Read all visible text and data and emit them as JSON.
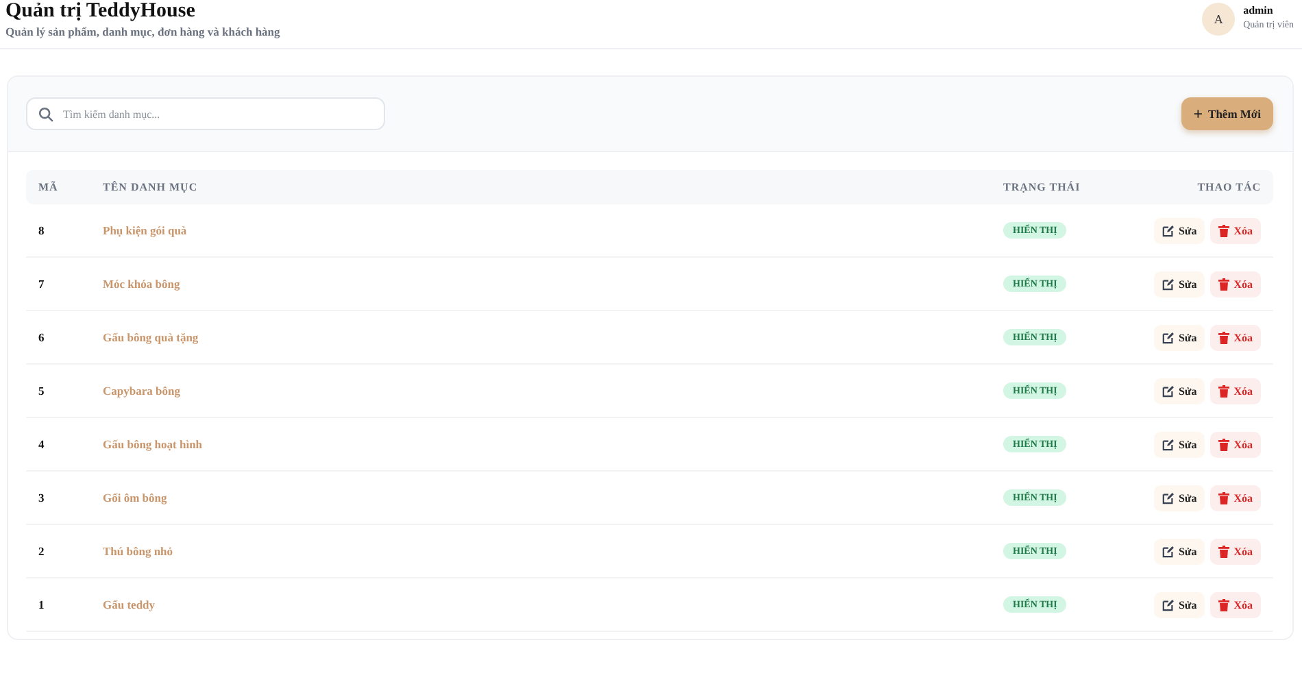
{
  "header": {
    "title": "Quản trị TeddyHouse",
    "subtitle": "Quản lý sản phẩm, danh mục, đơn hàng và khách hàng",
    "user": {
      "avatar": "A",
      "name": "admin",
      "role": "Quản trị viên"
    }
  },
  "toolbar": {
    "search": {
      "placeholder": "Tìm kiếm danh mục..."
    },
    "add_button": {
      "icon": "+",
      "label": "Thêm Mới"
    }
  },
  "table": {
    "columns": [
      "MÃ",
      "TÊN DANH MỤC",
      "TRẠNG THÁI",
      "THAO TÁC"
    ],
    "rows": [
      {
        "id": "8",
        "name": "Phụ kiện gói quà",
        "status": {
          "label": "HIỂN THỊ",
          "visible": true
        },
        "actions": [
          "Sửa",
          "Xóa"
        ]
      },
      {
        "id": "7",
        "name": "Móc khóa bông",
        "status": {
          "label": "HIỂN THỊ",
          "visible": true
        },
        "actions": [
          "Sửa",
          "Xóa"
        ]
      },
      {
        "id": "6",
        "name": "Gấu bông quà tặng",
        "status": {
          "label": "HIỂN THỊ",
          "visible": true
        },
        "actions": [
          "Sửa",
          "Xóa"
        ]
      },
      {
        "id": "5",
        "name": "Capybara bông",
        "status": {
          "label": "HIỂN THỊ",
          "visible": true
        },
        "actions": [
          "Sửa",
          "Xóa"
        ]
      },
      {
        "id": "4",
        "name": "Gấu bông hoạt hình",
        "status": {
          "label": "HIỂN THỊ",
          "visible": true
        },
        "actions": [
          "Sửa",
          "Xóa"
        ]
      },
      {
        "id": "3",
        "name": "Gối ôm bông",
        "status": {
          "label": "HIỂN THỊ",
          "visible": true
        },
        "actions": [
          "Sửa",
          "Xóa"
        ]
      },
      {
        "id": "2",
        "name": "Thú bông nhỏ",
        "status": {
          "label": "HIỂN THỊ",
          "visible": true
        },
        "actions": [
          "Sửa",
          "Xóa"
        ]
      },
      {
        "id": "1",
        "name": "Gấu teddy",
        "status": {
          "label": "HIỂN THỊ",
          "visible": true
        },
        "actions": [
          "Sửa",
          "Xóa"
        ]
      }
    ]
  }
}
